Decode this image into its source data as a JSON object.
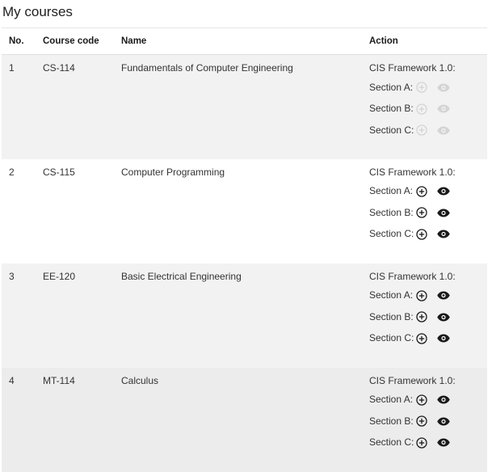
{
  "page": {
    "title": "My courses"
  },
  "table": {
    "headers": {
      "no": "No.",
      "code": "Course code",
      "name": "Name",
      "action": "Action"
    },
    "rows": [
      {
        "no": "1",
        "code": "CS-114",
        "name": "Fundamentals of Computer Engineering",
        "framework": "CIS Framework 1.0:",
        "sections": [
          "Section A:",
          "Section B:",
          "Section C:"
        ],
        "enabled": false
      },
      {
        "no": "2",
        "code": "CS-115",
        "name": "Computer Programming",
        "framework": "CIS Framework 1.0:",
        "sections": [
          "Section A:",
          "Section B:",
          "Section C:"
        ],
        "enabled": true
      },
      {
        "no": "3",
        "code": "EE-120",
        "name": "Basic Electrical Engineering",
        "framework": "CIS Framework 1.0:",
        "sections": [
          "Section A:",
          "Section B:",
          "Section C:"
        ],
        "enabled": true
      },
      {
        "no": "4",
        "code": "MT-114",
        "name": "Calculus",
        "framework": "CIS Framework 1.0:",
        "sections": [
          "Section A:",
          "Section B:",
          "Section C:"
        ],
        "enabled": true
      }
    ]
  },
  "icons": {
    "add": "add-circle-icon",
    "view": "eye-icon"
  },
  "colors": {
    "icon_active": "#1a1a1a",
    "icon_disabled": "#9e9e9e"
  }
}
